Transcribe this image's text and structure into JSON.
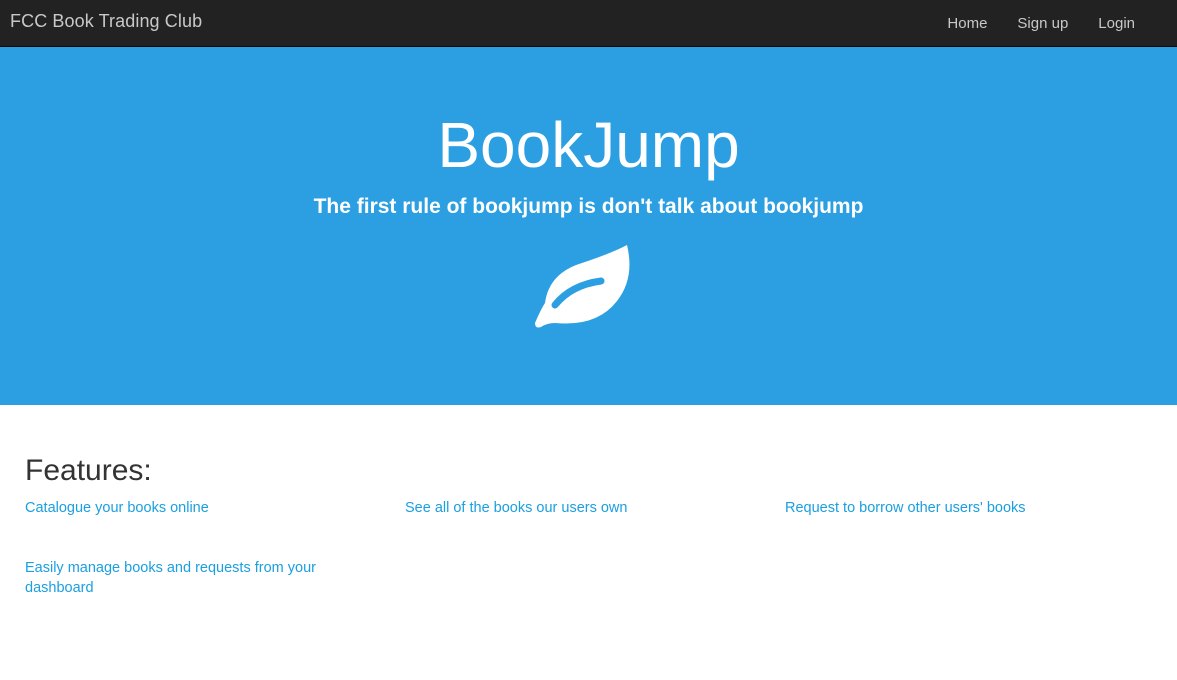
{
  "navbar": {
    "brand": "FCC Book Trading Club",
    "links": [
      "Home",
      "Sign up",
      "Login"
    ]
  },
  "hero": {
    "title": "BookJump",
    "subtitle": "The first rule of bookjump is don't talk about bookjump",
    "icon": "leaf-icon",
    "background_color": "#2b9fe2"
  },
  "features": {
    "title": "Features:",
    "items": [
      "Catalogue your books online",
      "See all of the books our users own",
      "Request to borrow other users' books",
      "Easily manage books and requests from your dashboard"
    ],
    "link_color": "#1a9fe0"
  }
}
